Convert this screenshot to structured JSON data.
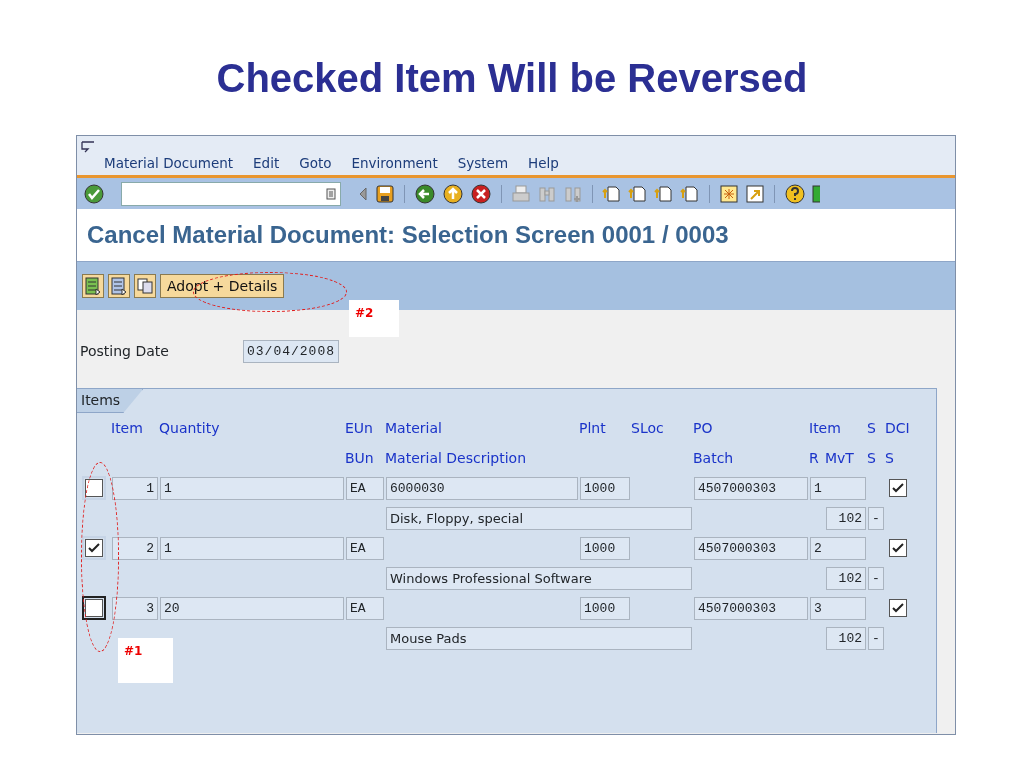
{
  "slide_title": "Checked Item Will be Reversed",
  "window": {
    "menu": [
      "Material Document",
      "Edit",
      "Goto",
      "Environment",
      "System",
      "Help"
    ],
    "title": "Cancel Material Document: Selection Screen 0001 / 0003",
    "app_toolbar": {
      "button": "Adopt + Details"
    },
    "posting_date": {
      "label": "Posting Date",
      "value": "03/04/2008"
    },
    "items_tab": {
      "label": "Items"
    },
    "table": {
      "header_row_1": [
        "Item",
        "Quantity",
        "EUn",
        "Material",
        "Plnt",
        "SLoc",
        "PO",
        "Item",
        "S",
        "DCI"
      ],
      "header_row_2": [
        "BUn",
        "Material Description",
        "Batch",
        "R",
        "MvT",
        "S",
        "S"
      ],
      "rows": [
        {
          "checked": false,
          "focused": false,
          "item": "1",
          "quantity": "1",
          "unit": "EA",
          "material": "6000030",
          "plant": "1000",
          "po": "4507000303",
          "po_item": "1",
          "description": "Disk, Floppy, special",
          "mvt": "102",
          "s": "-",
          "dci": true
        },
        {
          "checked": true,
          "focused": false,
          "item": "2",
          "quantity": "1",
          "unit": "EA",
          "material": "",
          "plant": "1000",
          "po": "4507000303",
          "po_item": "2",
          "description": "Windows Professional Software",
          "mvt": "102",
          "s": "-",
          "dci": true
        },
        {
          "checked": false,
          "focused": true,
          "item": "3",
          "quantity": "20",
          "unit": "EA",
          "material": "",
          "plant": "1000",
          "po": "4507000303",
          "po_item": "3",
          "description": "Mouse Pads",
          "mvt": "102",
          "s": "-",
          "dci": true
        }
      ]
    }
  },
  "annotations": [
    {
      "label": "#2"
    },
    {
      "label": "#1"
    }
  ]
}
